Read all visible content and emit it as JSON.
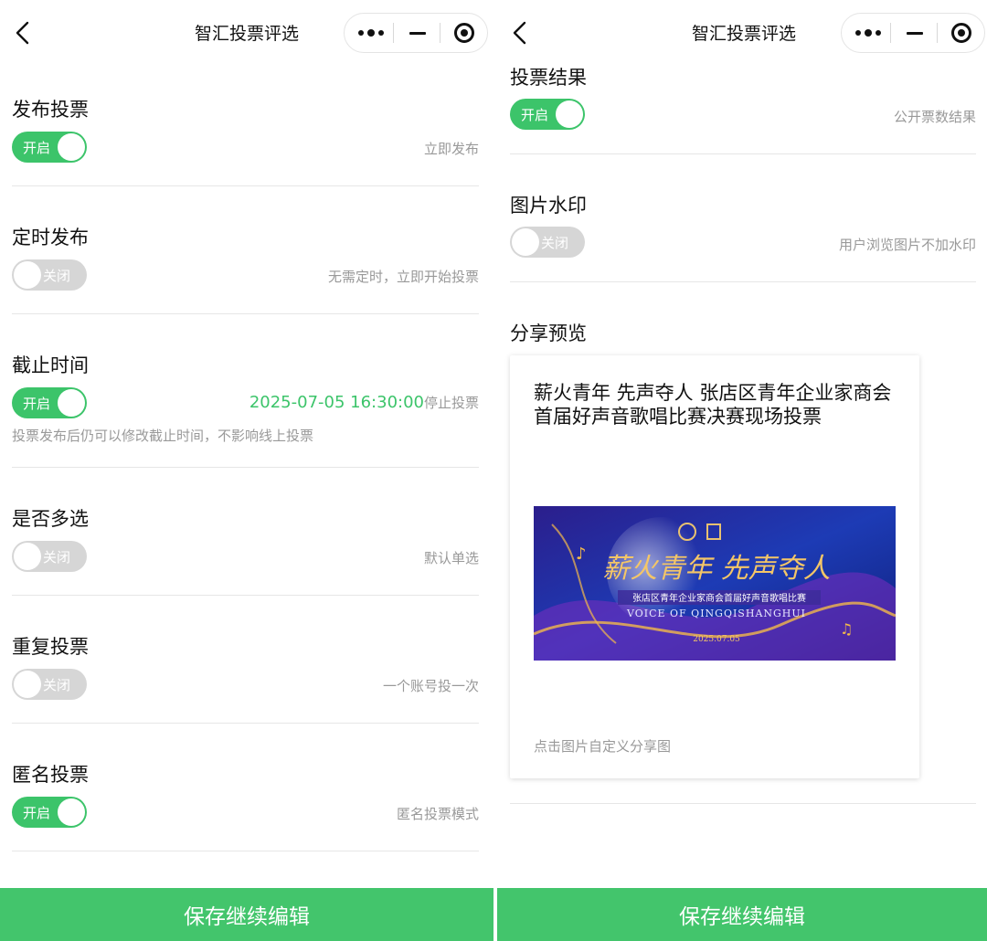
{
  "nav": {
    "title": "智汇投票评选"
  },
  "left": {
    "items": [
      {
        "title": "发布投票",
        "toggle": "开启",
        "desc": "立即发布"
      },
      {
        "title": "定时发布",
        "toggle": "关闭",
        "desc": "无需定时，立即开始投票"
      },
      {
        "title": "截止时间",
        "toggle": "开启",
        "date": "2025-07-05  16:30:00",
        "desc": "停止投票",
        "note": "投票发布后仍可以修改截止时间，不影响线上投票"
      },
      {
        "title": "是否多选",
        "toggle": "关闭",
        "desc": "默认单选"
      },
      {
        "title": "重复投票",
        "toggle": "关闭",
        "desc": "一个账号投一次"
      },
      {
        "title": "匿名投票",
        "toggle": "开启",
        "desc": "匿名投票模式"
      }
    ]
  },
  "right": {
    "items": [
      {
        "title": "投票结果",
        "toggle": "开启",
        "desc": "公开票数结果"
      },
      {
        "title": "图片水印",
        "toggle": "关闭",
        "desc": "用户浏览图片不加水印"
      }
    ],
    "share": {
      "title": "分享预览",
      "card_title": "薪火青年 先声夺人 张店区青年企业家商会首届好声音歌唱比赛决赛现场投票",
      "image_headline": "薪火青年 先声夺人",
      "image_subtitle": "张店区青年企业家商会首届好声音歌唱比赛",
      "image_voice": "VOICE OF QINGQISHANGHUI",
      "image_date": "2025.07.05",
      "hint": "点击图片自定义分享图"
    }
  },
  "footer": {
    "save_label": "保存继续编辑"
  },
  "colors": {
    "accent": "#3cc46a",
    "save_bar": "#43c56c",
    "toggle_off": "#d6d6d6",
    "muted_text": "#999999",
    "divider": "#e6e6e6"
  }
}
